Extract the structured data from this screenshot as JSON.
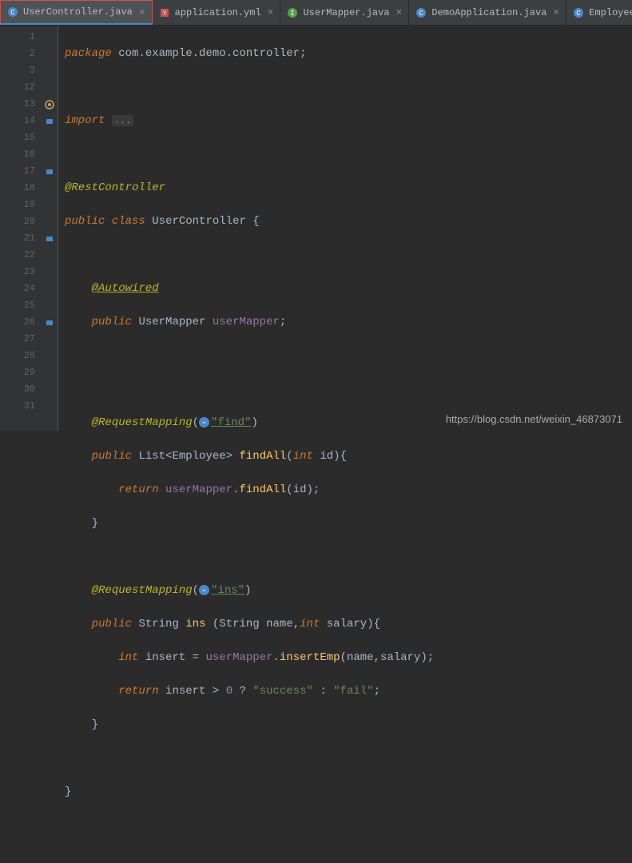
{
  "tabs": [
    {
      "label": "UserController.java",
      "active": true,
      "icon": "class-icon"
    },
    {
      "label": "application.yml",
      "active": false,
      "icon": "yaml-icon"
    },
    {
      "label": "UserMapper.java",
      "active": false,
      "icon": "interface-icon"
    },
    {
      "label": "DemoApplication.java",
      "active": false,
      "icon": "class-icon"
    },
    {
      "label": "Employee.java",
      "active": false,
      "icon": "class-icon"
    }
  ],
  "gutter_lines": [
    "1",
    "2",
    "3",
    "12",
    "13",
    "14",
    "15",
    "16",
    "17",
    "18",
    "19",
    "20",
    "21",
    "22",
    "23",
    "24",
    "25",
    "26",
    "27",
    "28",
    "29",
    "30",
    "31",
    ""
  ],
  "code": {
    "l1_pkg_kw": "package",
    "l1_pkg": "com.example.demo.controller",
    "l3_import": "import",
    "l3_fold": "...",
    "l13_anno": "@RestController",
    "l14_public": "public",
    "l14_class": "class",
    "l14_name": "UserController",
    "l16_anno": "@Autowired",
    "l17_public": "public",
    "l17_type": "UserMapper",
    "l17_field": "userMapper",
    "l20_anno": "@RequestMapping",
    "l20_str": "\"find\"",
    "l21_public": "public",
    "l21_list": "List",
    "l21_emp": "Employee",
    "l21_method": "findAll",
    "l21_int": "int",
    "l21_param": "id",
    "l22_return": "return",
    "l22_obj": "userMapper",
    "l22_call": "findAll",
    "l22_arg": "id",
    "l25_anno": "@RequestMapping",
    "l25_str": "\"ins\"",
    "l26_public": "public",
    "l26_type": "String",
    "l26_method": "ins",
    "l26_t1": "String",
    "l26_p1": "name",
    "l26_t2": "int",
    "l26_p2": "salary",
    "l27_int": "int",
    "l27_var": "insert",
    "l27_obj": "userMapper",
    "l27_call": "insertEmp",
    "l27_a1": "name",
    "l27_a2": "salary",
    "l28_return": "return",
    "l28_var": "insert",
    "l28_zero": "0",
    "l28_succ": "\"success\"",
    "l28_fail": "\"fail\""
  },
  "watermark": "https://blog.csdn.net/weixin_46873071"
}
